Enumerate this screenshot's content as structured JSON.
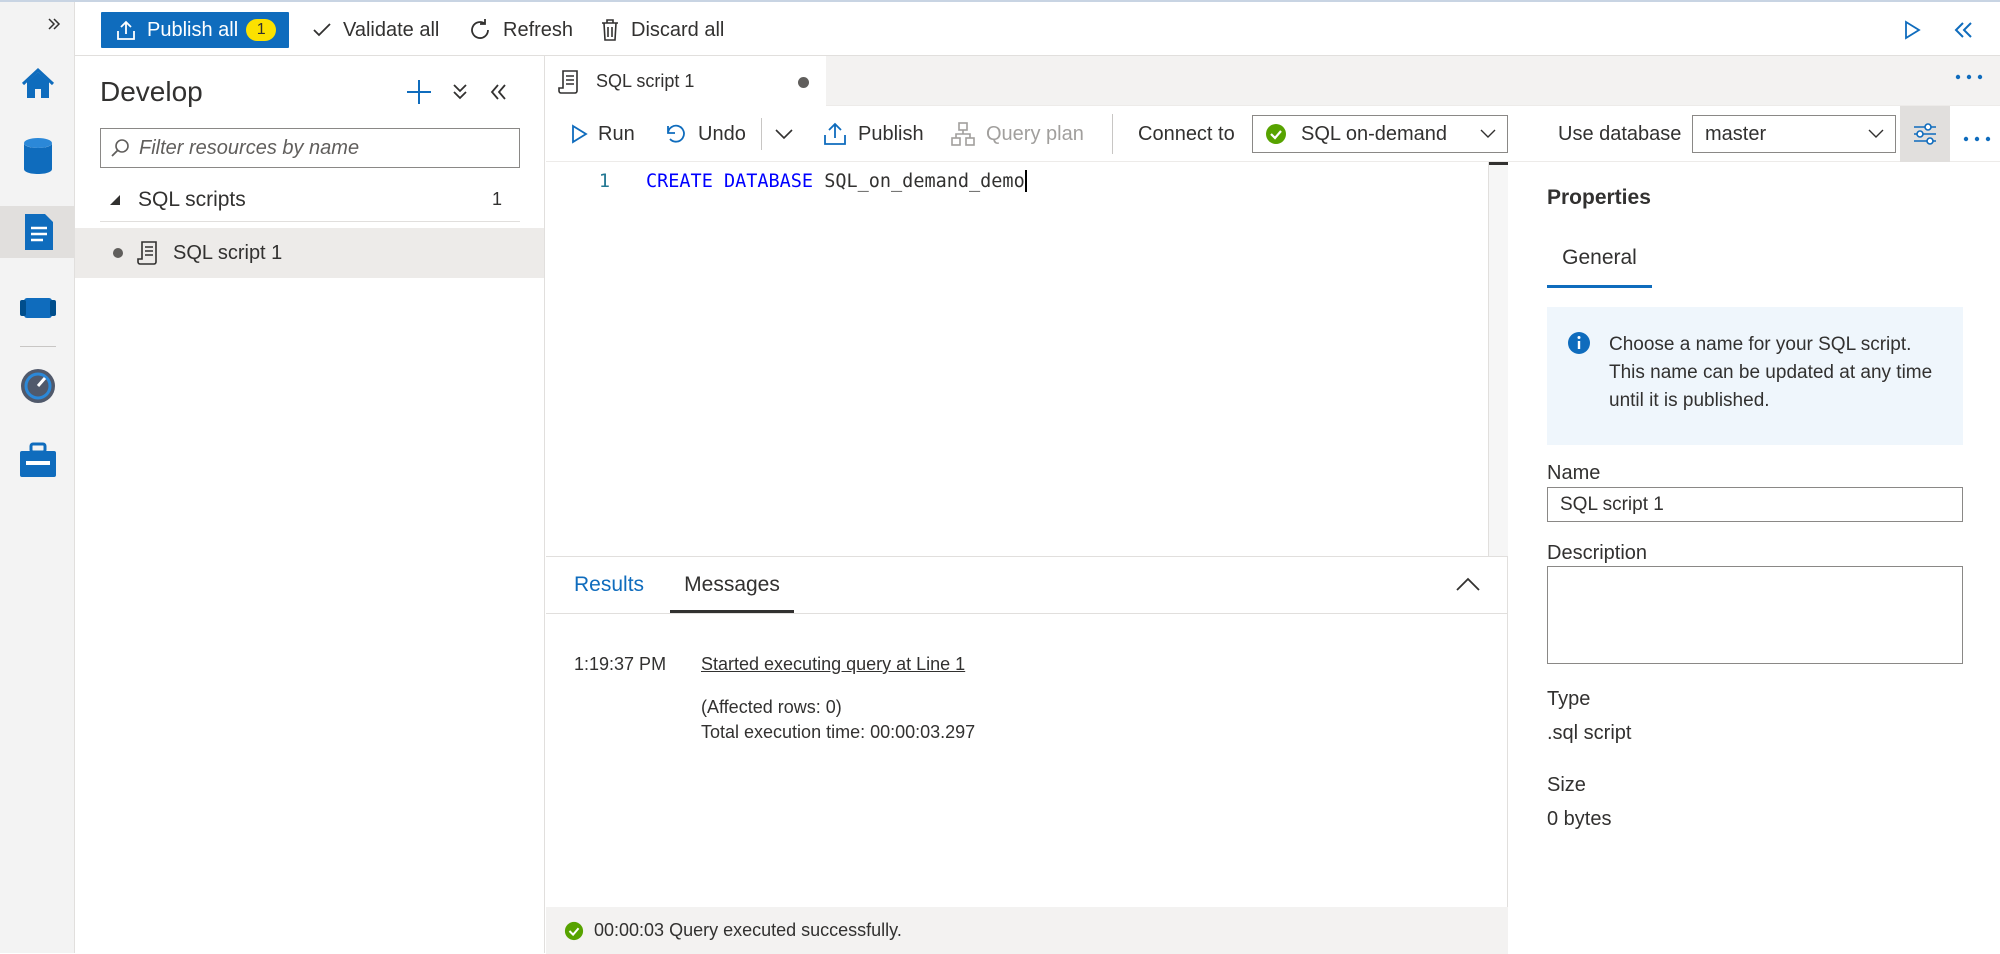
{
  "toolbar": {
    "publish_all_label": "Publish all",
    "publish_badge": "1",
    "validate_all_label": "Validate all",
    "refresh_label": "Refresh",
    "discard_all_label": "Discard all"
  },
  "develop": {
    "title": "Develop",
    "filter_placeholder": "Filter resources by name",
    "group_label": "SQL scripts",
    "group_count": "1",
    "item_label": "SQL script 1"
  },
  "tab": {
    "label": "SQL script 1"
  },
  "editor_toolbar": {
    "run_label": "Run",
    "undo_label": "Undo",
    "publish_label": "Publish",
    "query_plan_label": "Query plan",
    "connect_to_label": "Connect to",
    "connect_value": "SQL on-demand",
    "use_database_label": "Use database",
    "database_value": "master"
  },
  "editor": {
    "line_number": "1",
    "keyword1": "CREATE",
    "keyword2": "DATABASE",
    "identifier": "SQL_on_demand_demo"
  },
  "results": {
    "tab_results": "Results",
    "tab_messages": "Messages",
    "timestamp": "1:19:37 PM",
    "message_link": "Started executing query at Line 1",
    "affected_rows": "(Affected rows: 0)",
    "execution_time": "Total execution time: 00:00:03.297",
    "status_text": "00:00:03 Query executed successfully."
  },
  "properties": {
    "title": "Properties",
    "tab_general": "General",
    "info_text": "Choose a name for your SQL script. This name can be updated at any time until it is published.",
    "name_label": "Name",
    "name_value": "SQL script 1",
    "description_label": "Description",
    "description_value": "",
    "type_label": "Type",
    "type_value": ".sql script",
    "size_label": "Size",
    "size_value": "0 bytes"
  },
  "colors": {
    "accent": "#0f6cbd",
    "badge": "#fce100",
    "success": "#57a300",
    "keyword": "#0000ff",
    "info_bg": "#eff6fc"
  },
  "icons": [
    "expand-icon",
    "home-icon",
    "data-icon",
    "develop-icon",
    "integrate-icon",
    "monitor-icon",
    "manage-icon",
    "publish-icon",
    "check-icon",
    "refresh-icon",
    "trash-icon",
    "run-icon",
    "collapse-icon",
    "plus-icon",
    "expand-all-icon",
    "script-icon",
    "search-icon",
    "undo-icon",
    "chevron-down-icon",
    "query-plan-icon",
    "success-icon",
    "settings-icon",
    "more-icon",
    "info-icon",
    "chevron-up-icon"
  ]
}
